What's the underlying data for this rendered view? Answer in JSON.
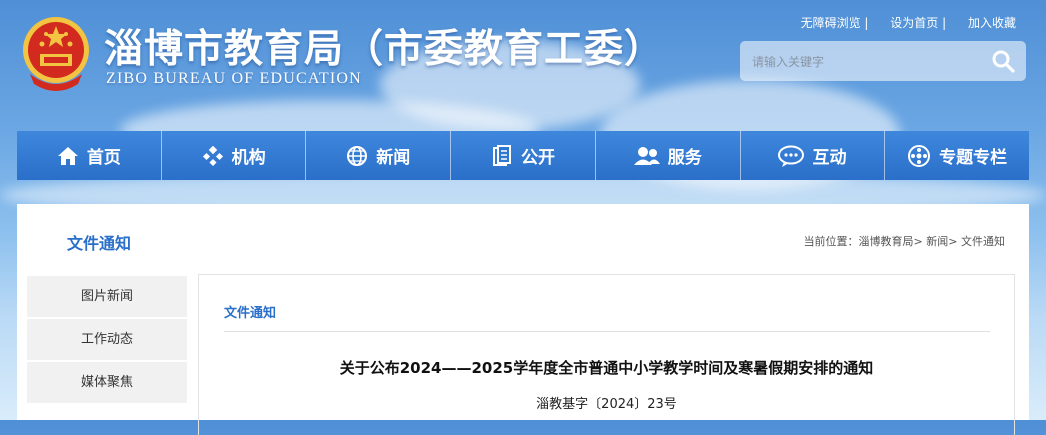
{
  "header": {
    "title": "淄博市教育局（市委教育工委）",
    "subtitle": "ZIBO BUREAU OF EDUCATION",
    "top_links": [
      "无障碍浏览 |",
      "设为首页 |",
      "加入收藏"
    ],
    "search_placeholder": "请输入关键字",
    "search_icon": "search-icon"
  },
  "nav": {
    "items": [
      {
        "label": "首页",
        "icon": "home-icon"
      },
      {
        "label": "机构",
        "icon": "org-icon"
      },
      {
        "label": "新闻",
        "icon": "globe-icon"
      },
      {
        "label": "公开",
        "icon": "document-icon"
      },
      {
        "label": "服务",
        "icon": "users-icon"
      },
      {
        "label": "互动",
        "icon": "chat-icon"
      },
      {
        "label": "专题专栏",
        "icon": "plus-circle-icon"
      }
    ]
  },
  "main": {
    "section_title": "文件通知",
    "breadcrumb": "当前位置：淄博教育局> 新闻> 文件通知",
    "sidebar": [
      "图片新闻",
      "工作动态",
      "媒体聚焦"
    ],
    "content_category": "文件通知",
    "article_title": "关于公布2024——2025学年度全市普通中小学教学时间及寒暑假期安排的通知",
    "doc_number": "淄教基字〔2024〕23号"
  },
  "colors": {
    "accent": "#2a6fc9",
    "nav_bg": "#3a82d8",
    "emblem_red": "#d22a1f",
    "emblem_gold": "#f3c342"
  }
}
